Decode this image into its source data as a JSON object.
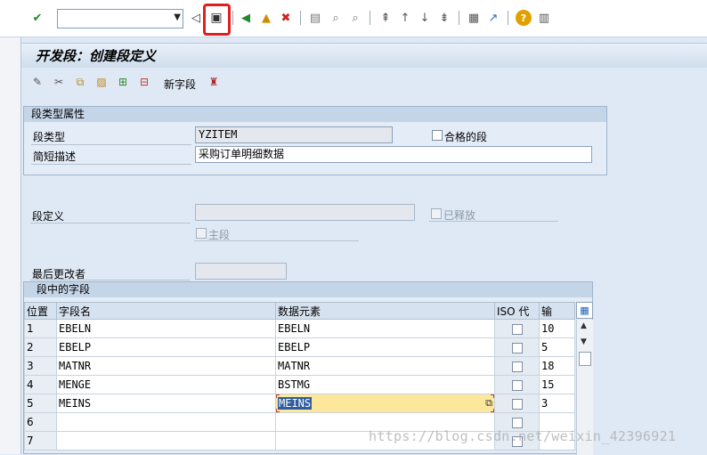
{
  "toolbar": {
    "command_value": "",
    "icons": [
      "enter-icon",
      "back-nav-icon",
      "save-icon",
      "back-icon",
      "exit-icon",
      "cancel-icon",
      "print-icon",
      "find-icon",
      "find-next-icon",
      "first-page-icon",
      "previous-page-icon",
      "next-page-icon",
      "last-page-icon",
      "create-session-icon",
      "shortcut-icon",
      "help-icon",
      "layout-icon"
    ]
  },
  "title": "开发段：创建段定义",
  "app_toolbar": {
    "new_field_label": "新字段"
  },
  "attributes": {
    "group_title": "段类型属性",
    "segment_type_label": "段类型",
    "segment_type_value": "YZITEM",
    "qualified_label": "合格的段",
    "qualified_checked": false,
    "short_desc_label": "简短描述",
    "short_desc_value": "采购订单明细数据"
  },
  "definition": {
    "label": "段定义",
    "value": "",
    "released_label": "已释放",
    "released_checked": false,
    "main_segment_label": "主段",
    "main_segment_checked": false,
    "last_changed_label": "最后更改者",
    "last_changed_value": ""
  },
  "fields_table": {
    "group_title": "段中的字段",
    "columns": [
      "位置",
      "字段名",
      "数据元素",
      "ISO 代",
      "输"
    ],
    "rows": [
      {
        "pos": "1",
        "field": "EBELN",
        "element": "EBELN",
        "iso": false,
        "len": "10"
      },
      {
        "pos": "2",
        "field": "EBELP",
        "element": "EBELP",
        "iso": false,
        "len": "5"
      },
      {
        "pos": "3",
        "field": "MATNR",
        "element": "MATNR",
        "iso": false,
        "len": "18"
      },
      {
        "pos": "4",
        "field": "MENGE",
        "element": "BSTMG",
        "iso": false,
        "len": "15"
      },
      {
        "pos": "5",
        "field": "MEINS",
        "element": "MEINS",
        "iso": false,
        "len": "3"
      },
      {
        "pos": "6",
        "field": "",
        "element": "",
        "iso": false,
        "len": ""
      },
      {
        "pos": "7",
        "field": "",
        "element": "",
        "iso": false,
        "len": ""
      }
    ]
  },
  "watermark": "https://blog.csdn.net/weixin_42396921",
  "colors": {
    "highlight": "#e21f1f",
    "selected_cell": "#fde79a",
    "header_bg": "#c5d5e8"
  }
}
